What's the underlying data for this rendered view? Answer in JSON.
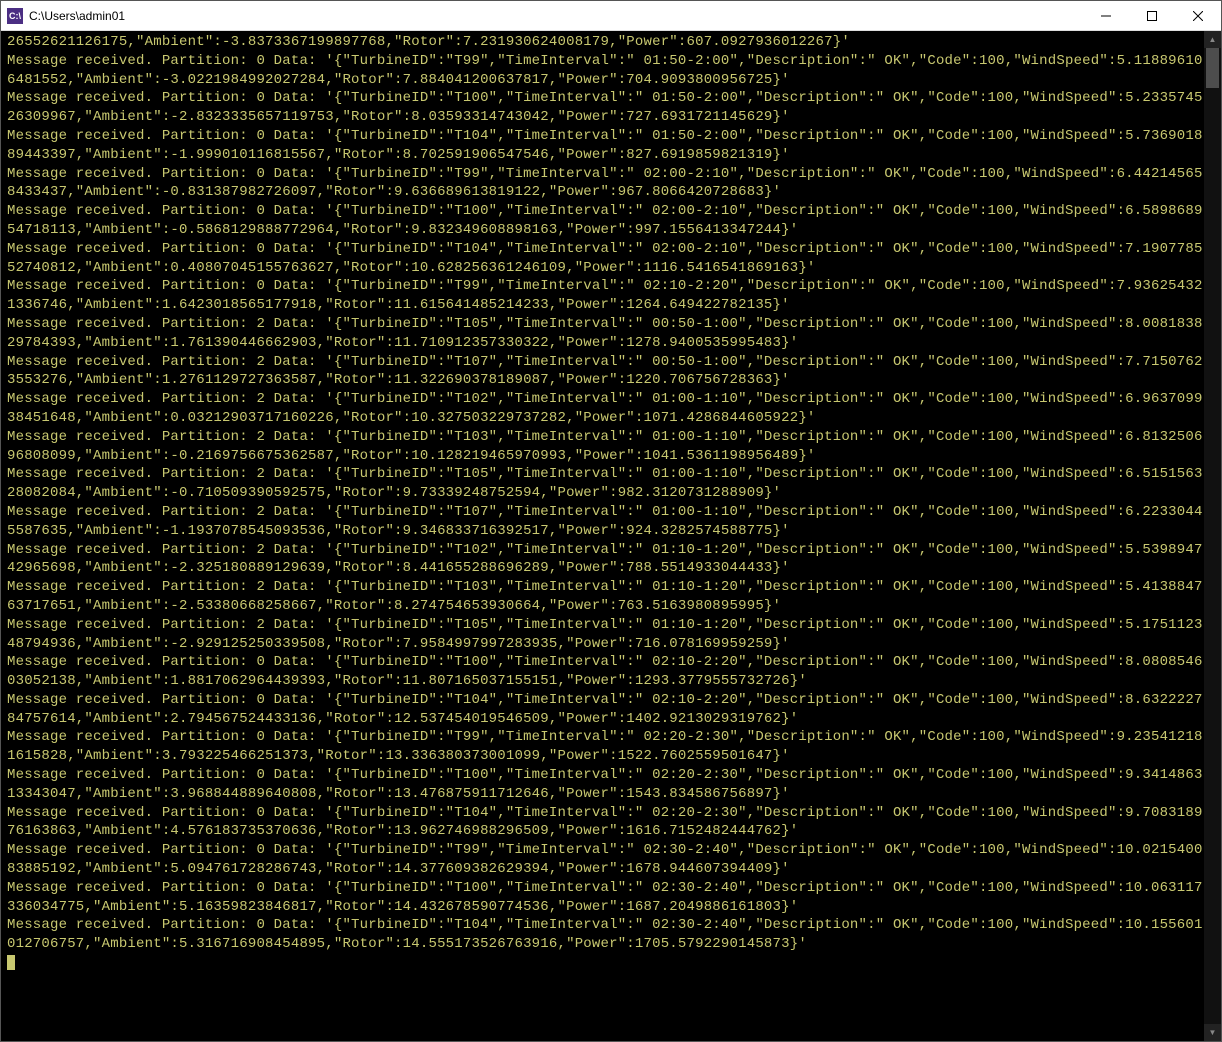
{
  "title": "C:\\Users\\admin01",
  "appIconText": "C:\\",
  "colors": {
    "terminal_fg": "#c8c870",
    "terminal_bg": "#000000",
    "titlebar_bg": "#ffffff"
  },
  "partial_first_line": "26552621126175,\"Ambient\":-3.8373367199897768,\"Rotor\":7.231930624008179,\"Power\":607.0927936012267}'",
  "messages": [
    {
      "partition": 0,
      "TurbineID": "T99",
      "TimeInterval": " 01:50-2:00",
      "Description": " OK",
      "Code": 100,
      "WindSpeed": 5.118896106481552,
      "Ambient": -3.0221984992027284,
      "Rotor": 7.884041200637817,
      "Power": 704.9093800956725
    },
    {
      "partition": 0,
      "TurbineID": "T100",
      "TimeInterval": " 01:50-2:00",
      "Description": " OK",
      "Code": 100,
      "WindSpeed": 5.233574526309967,
      "Ambient": -2.8323335657119753,
      "Rotor": 8.03593314743042,
      "Power": 727.6931721145629
    },
    {
      "partition": 0,
      "TurbineID": "T104",
      "TimeInterval": " 01:50-2:00",
      "Description": " OK",
      "Code": 100,
      "WindSpeed": 5.736901889443397,
      "Ambient": -1.999010116815567,
      "Rotor": 8.702591906547546,
      "Power": 827.6919859821319
    },
    {
      "partition": 0,
      "TurbineID": "T99",
      "TimeInterval": " 02:00-2:10",
      "Description": " OK",
      "Code": 100,
      "WindSpeed": 6.442145658433437,
      "Ambient": -0.831387982726097,
      "Rotor": 9.636689613819122,
      "Power": 967.8066420728683
    },
    {
      "partition": 0,
      "TurbineID": "T100",
      "TimeInterval": " 02:00-2:10",
      "Description": " OK",
      "Code": 100,
      "WindSpeed": 6.589868954718113,
      "Ambient": -0.5868129888772964,
      "Rotor": 9.832349608898163,
      "Power": 997.1556413347244
    },
    {
      "partition": 0,
      "TurbineID": "T104",
      "TimeInterval": " 02:00-2:10",
      "Description": " OK",
      "Code": 100,
      "WindSpeed": 7.190778552740812,
      "Ambient": 0.40807045155763627,
      "Rotor": 10.628256361246109,
      "Power": 1116.5416541869163
    },
    {
      "partition": 0,
      "TurbineID": "T99",
      "TimeInterval": " 02:10-2:20",
      "Description": " OK",
      "Code": 100,
      "WindSpeed": 7.936254321336746,
      "Ambient": 1.6423018565177918,
      "Rotor": 11.615641485214233,
      "Power": 1264.649422782135
    },
    {
      "partition": 2,
      "TurbineID": "T105",
      "TimeInterval": " 00:50-1:00",
      "Description": " OK",
      "Code": 100,
      "WindSpeed": 8.008183829784393,
      "Ambient": 1.761390446662903,
      "Rotor": 11.710912357330322,
      "Power": 1278.9400535995483
    },
    {
      "partition": 2,
      "TurbineID": "T107",
      "TimeInterval": " 00:50-1:00",
      "Description": " OK",
      "Code": 100,
      "WindSpeed": 7.71507623553276,
      "Ambient": 1.2761129727363587,
      "Rotor": 11.322690378189087,
      "Power": 1220.706756728363
    },
    {
      "partition": 2,
      "TurbineID": "T102",
      "TimeInterval": " 01:00-1:10",
      "Description": " OK",
      "Code": 100,
      "WindSpeed": 6.963709938451648,
      "Ambient": 0.03212903717160226,
      "Rotor": 10.327503229737282,
      "Power": 1071.4286844605922
    },
    {
      "partition": 2,
      "TurbineID": "T103",
      "TimeInterval": " 01:00-1:10",
      "Description": " OK",
      "Code": 100,
      "WindSpeed": 6.813250696808099,
      "Ambient": -0.2169756675362587,
      "Rotor": 10.128219465970993,
      "Power": 1041.5361198956489
    },
    {
      "partition": 2,
      "TurbineID": "T105",
      "TimeInterval": " 01:00-1:10",
      "Description": " OK",
      "Code": 100,
      "WindSpeed": 6.515156328082084,
      "Ambient": -0.710509390592575,
      "Rotor": 9.73339248752594,
      "Power": 982.3120731288909
    },
    {
      "partition": 2,
      "TurbineID": "T107",
      "TimeInterval": " 01:00-1:10",
      "Description": " OK",
      "Code": 100,
      "WindSpeed": 6.22330445587635,
      "Ambient": -1.1937078545093536,
      "Rotor": 9.346833716392517,
      "Power": 924.3282574588775
    },
    {
      "partition": 2,
      "TurbineID": "T102",
      "TimeInterval": " 01:10-1:20",
      "Description": " OK",
      "Code": 100,
      "WindSpeed": 5.539894742965698,
      "Ambient": -2.325180889129639,
      "Rotor": 8.441655288696289,
      "Power": 788.5514933044433
    },
    {
      "partition": 2,
      "TurbineID": "T103",
      "TimeInterval": " 01:10-1:20",
      "Description": " OK",
      "Code": 100,
      "WindSpeed": 5.413884763717651,
      "Ambient": -2.53380668258667,
      "Rotor": 8.274754653930664,
      "Power": 763.5163980895995
    },
    {
      "partition": 2,
      "TurbineID": "T105",
      "TimeInterval": " 01:10-1:20",
      "Description": " OK",
      "Code": 100,
      "WindSpeed": 5.175112348794936,
      "Ambient": -2.929125250339508,
      "Rotor": 7.9584997997283935,
      "Power": 716.078169959259
    },
    {
      "partition": 0,
      "TurbineID": "T100",
      "TimeInterval": " 02:10-2:20",
      "Description": " OK",
      "Code": 100,
      "WindSpeed": 8.080854603052138,
      "Ambient": 1.8817062964439393,
      "Rotor": 11.807165037155151,
      "Power": 1293.3779555732726
    },
    {
      "partition": 0,
      "TurbineID": "T104",
      "TimeInterval": " 02:10-2:20",
      "Description": " OK",
      "Code": 100,
      "WindSpeed": 8.632222784757614,
      "Ambient": 2.794567524433136,
      "Rotor": 12.537454019546509,
      "Power": 1402.9213029319762
    },
    {
      "partition": 0,
      "TurbineID": "T99",
      "TimeInterval": " 02:20-2:30",
      "Description": " OK",
      "Code": 100,
      "WindSpeed": 9.235412181615828,
      "Ambient": 3.793225466251373,
      "Rotor": 13.336380373001099,
      "Power": 1522.7602559501647
    },
    {
      "partition": 0,
      "TurbineID": "T100",
      "TimeInterval": " 02:20-2:30",
      "Description": " OK",
      "Code": 100,
      "WindSpeed": 9.341486313343047,
      "Ambient": 3.968844889640808,
      "Rotor": 13.476875911712646,
      "Power": 1543.834586756897
    },
    {
      "partition": 0,
      "TurbineID": "T104",
      "TimeInterval": " 02:20-2:30",
      "Description": " OK",
      "Code": 100,
      "WindSpeed": 9.708318976163863,
      "Ambient": 4.576183735370636,
      "Rotor": 13.962746988296509,
      "Power": 1616.7152482444762
    },
    {
      "partition": 0,
      "TurbineID": "T99",
      "TimeInterval": " 02:30-2:40",
      "Description": " OK",
      "Code": 100,
      "WindSpeed": 10.021540083885192,
      "Ambient": 5.094761728286743,
      "Rotor": 14.377609382629394,
      "Power": 1678.944607394409
    },
    {
      "partition": 0,
      "TurbineID": "T100",
      "TimeInterval": " 02:30-2:40",
      "Description": " OK",
      "Code": 100,
      "WindSpeed": 10.063117336034775,
      "Ambient": 5.16359823846817,
      "Rotor": 14.432678590774536,
      "Power": 1687.2049886161803
    },
    {
      "partition": 0,
      "TurbineID": "T104",
      "TimeInterval": " 02:30-2:40",
      "Description": " OK",
      "Code": 100,
      "WindSpeed": 10.155601012706757,
      "Ambient": 5.316716908454895,
      "Rotor": 14.555173526763916,
      "Power": 1705.5792290145873
    }
  ]
}
